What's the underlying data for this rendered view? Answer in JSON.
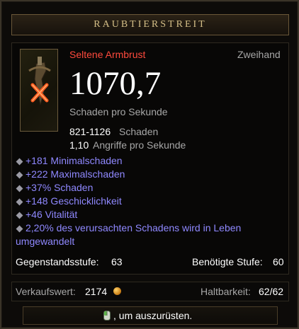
{
  "title": "RAUBTIERSTREIT",
  "item": {
    "quality_type": "Seltene Armbrust",
    "slot": "Zweihand",
    "dps": "1070,7",
    "dps_label": "Schaden pro Sekunde",
    "damage_value": "821-1126",
    "damage_label": "Schaden",
    "aps_value": "1,10",
    "aps_label": "Angriffe pro Sekunde"
  },
  "affixes": [
    "+181 Minimalschaden",
    "+222 Maximalschaden",
    "+37% Schaden",
    "+148 Geschicklichkeit",
    "+46 Vitalität",
    "2,20% des verursachten Schadens wird in Leben",
    "umgewandelt"
  ],
  "item_level_label": "Gegenstandsstufe:",
  "item_level": "63",
  "required_level_label": "Benötigte Stufe:",
  "required_level": "60",
  "sell_value_label": "Verkaufswert:",
  "sell_value": "2174",
  "durability_label": "Haltbarkeit:",
  "durability": "62/62",
  "equip_hint": ", um auszurüsten.",
  "colors": {
    "rare": "#ff4a3d",
    "magic_affix": "#8f88ff",
    "title_gold": "#d5bf87"
  },
  "icons": {
    "item": "crossbow-icon",
    "equipped_marker": "red-x-icon",
    "gold": "gold-coin-icon",
    "mouse": "mouse-icon"
  }
}
